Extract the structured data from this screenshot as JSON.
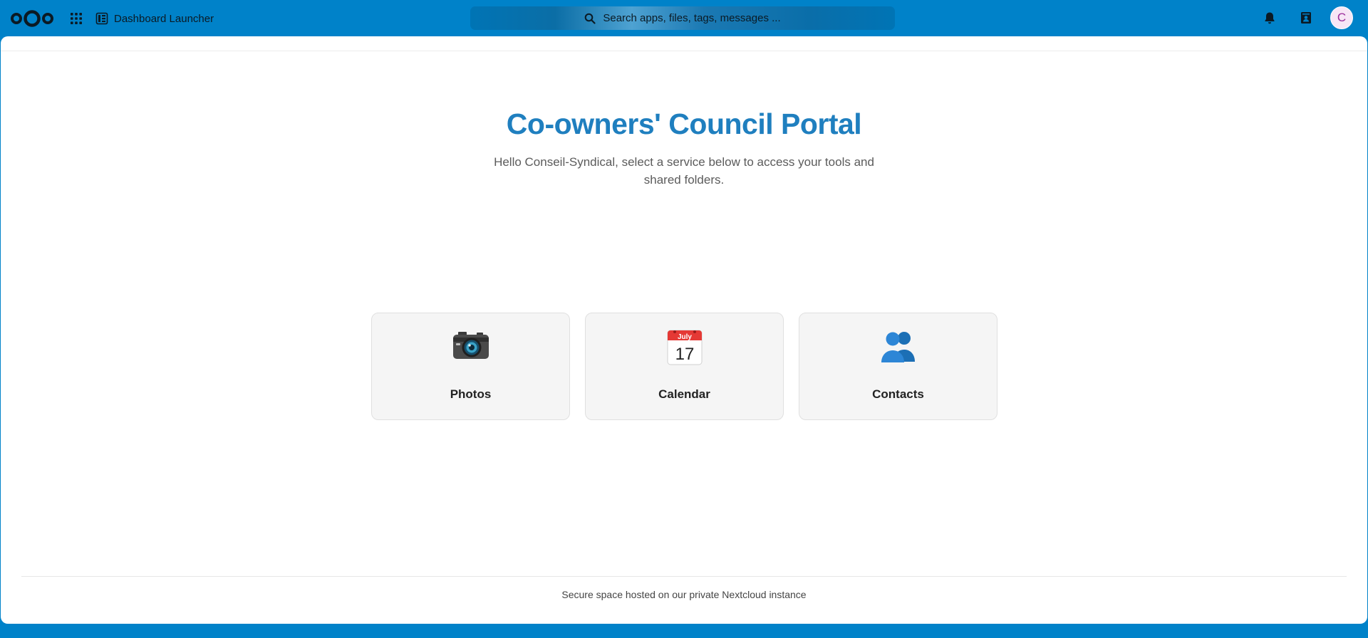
{
  "header": {
    "app_title": "Dashboard Launcher",
    "search_placeholder": "Search apps, files, tags, messages ...",
    "avatar_initial": "C",
    "icons": {
      "logo": "nextcloud-logo",
      "apps": "app-grid-icon",
      "app": "dashboard-icon",
      "search": "search-icon",
      "notifications": "bell-icon",
      "contacts": "contacts-menu-icon"
    },
    "colors": {
      "brand": "#0082c9",
      "avatar_bg": "#f7e6f6",
      "avatar_fg": "#9b2d9b"
    }
  },
  "main": {
    "title": "Co-owners' Council Portal",
    "subtitle": "Hello Conseil-Syndical, select a service below to access your tools and shared folders.",
    "title_color": "#1f7fbf",
    "cards": [
      {
        "label": "Photos",
        "icon": "camera-icon"
      },
      {
        "label": "Calendar",
        "icon": "calendar-icon",
        "icon_month": "July",
        "icon_day": "17"
      },
      {
        "label": "Contacts",
        "icon": "people-icon"
      }
    ]
  },
  "footer": {
    "text": "Secure space hosted on our private Nextcloud instance"
  }
}
